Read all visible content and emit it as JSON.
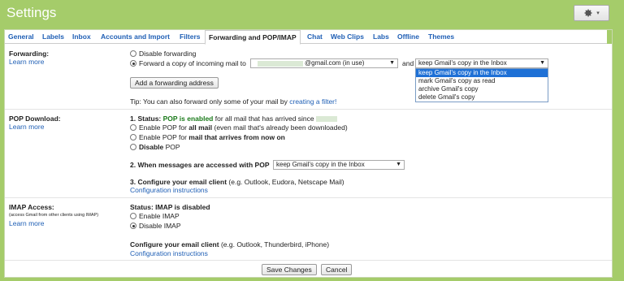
{
  "header": {
    "title": "Settings",
    "gear_icon": "gear-icon",
    "chevron_icon": "chevron-down-icon"
  },
  "tabs": [
    {
      "label": "General",
      "active": false
    },
    {
      "label": "Labels",
      "active": false
    },
    {
      "label": "Inbox",
      "active": false
    },
    {
      "label": "Accounts and Import",
      "active": false
    },
    {
      "label": "Filters",
      "active": false
    },
    {
      "label": "Forwarding and POP/IMAP",
      "active": true
    },
    {
      "label": "Chat",
      "active": false
    },
    {
      "label": "Web Clips",
      "active": false
    },
    {
      "label": "Labs",
      "active": false
    },
    {
      "label": "Offline",
      "active": false
    },
    {
      "label": "Themes",
      "active": false
    }
  ],
  "forwarding": {
    "label": "Forwarding:",
    "learn_more": "Learn more",
    "disable_label": "Disable forwarding",
    "forward_label": "Forward a copy of incoming mail to",
    "email_suffix": "@gmail.com (in use)",
    "and_label": "and",
    "action_selected": "keep Gmail's copy in the Inbox",
    "action_options": [
      "keep Gmail's copy in the Inbox",
      "mark Gmail's copy as read",
      "archive Gmail's copy",
      "delete Gmail's copy"
    ],
    "add_button": "Add a forwarding address",
    "tip_text": "Tip: You can also forward only some of your mail by",
    "tip_link": "creating a filter!"
  },
  "pop": {
    "label": "POP Download:",
    "learn_more": "Learn more",
    "status_prefix": "1. Status:",
    "status_value": "POP is enabled",
    "status_suffix": "for all mail that has arrived since",
    "opt1_pre": "Enable POP for",
    "opt1_bold": "all mail",
    "opt1_post": "(even mail that's already been downloaded)",
    "opt2_pre": "Enable POP for",
    "opt2_bold": "mail that arrives from now on",
    "opt3_bold": "Disable",
    "opt3_post": "POP",
    "when_label": "2. When messages are accessed with POP",
    "when_selected": "keep Gmail's copy in the Inbox",
    "configure_bold": "3. Configure your email client",
    "configure_rest": "(e.g. Outlook, Eudora, Netscape Mail)",
    "config_link": "Configuration instructions"
  },
  "imap": {
    "label": "IMAP Access:",
    "note": "(access Gmail from other clients using IMAP)",
    "learn_more": "Learn more",
    "status": "Status: IMAP is disabled",
    "enable_label": "Enable IMAP",
    "disable_label": "Disable IMAP",
    "configure_bold": "Configure your email client",
    "configure_rest": "(e.g. Outlook, Thunderbird, iPhone)",
    "config_link": "Configuration instructions"
  },
  "footer": {
    "save": "Save Changes",
    "cancel": "Cancel"
  },
  "colors": {
    "brand_green": "#a5cc6a",
    "link_blue": "#1f5fb5",
    "selected_blue": "#1e70d6",
    "status_green": "#1a7a1a"
  }
}
